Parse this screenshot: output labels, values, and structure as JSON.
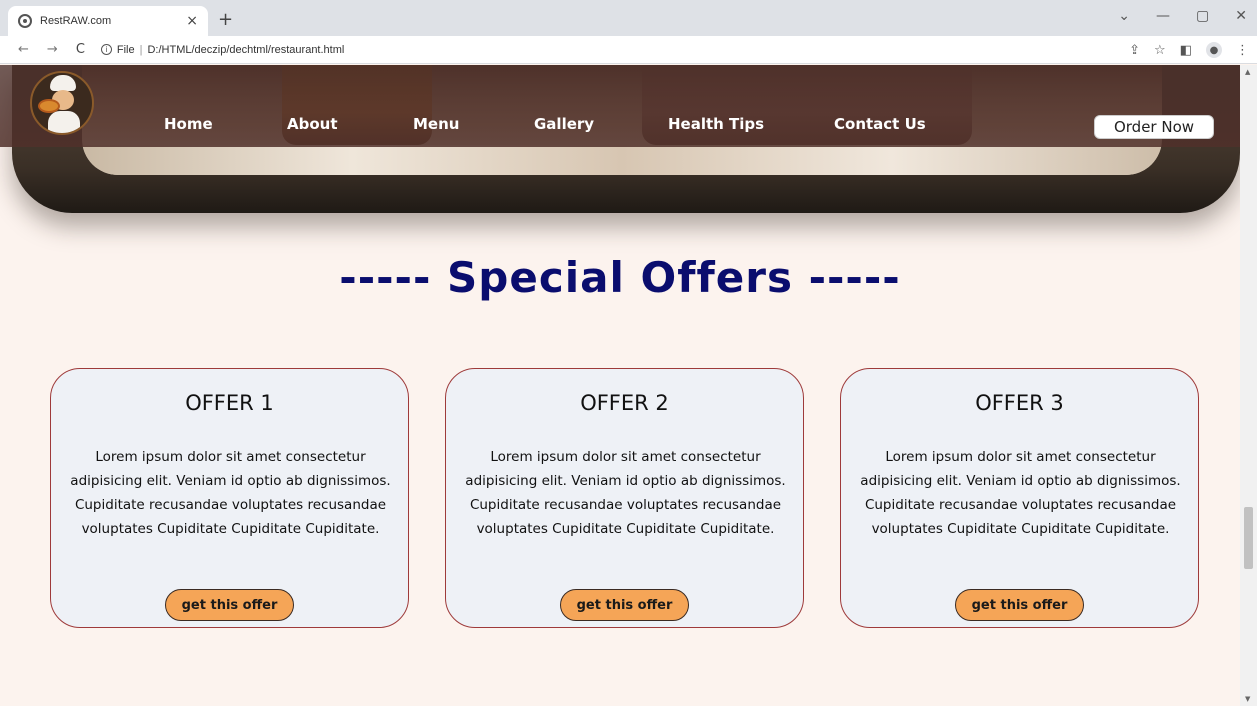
{
  "browser": {
    "tab_title": "RestRAW.com",
    "tab_close": "×",
    "new_tab": "+",
    "back": "←",
    "forward": "→",
    "reload": "C",
    "url_prefix": "File",
    "url_sep": "|",
    "url": "D:/HTML/deczip/dechtml/restaurant.html",
    "info_icon": "i",
    "share_icon": "⇪",
    "star_icon": "☆",
    "sidepanel_icon": "◧",
    "profile_icon": "●",
    "menu_icon": "⋮",
    "minimize": "—",
    "restore": "▢",
    "close": "✕",
    "chevron": "⌄"
  },
  "nav": {
    "items": [
      {
        "label": "Home"
      },
      {
        "label": "About"
      },
      {
        "label": "Menu"
      },
      {
        "label": "Gallery"
      },
      {
        "label": "Health Tips"
      },
      {
        "label": "Contact Us"
      }
    ],
    "order_label": "Order Now"
  },
  "section": {
    "title": "----- Special Offers -----"
  },
  "offers": [
    {
      "title": "OFFER 1",
      "text": "Lorem ipsum dolor sit amet consectetur adipisicing elit. Veniam id optio ab dignissimos. Cupiditate recusandae voluptates recusandae voluptates Cupiditate Cupiditate Cupiditate.",
      "button": "get this offer"
    },
    {
      "title": "OFFER 2",
      "text": "Lorem ipsum dolor sit amet consectetur adipisicing elit. Veniam id optio ab dignissimos. Cupiditate recusandae voluptates recusandae voluptates Cupiditate Cupiditate Cupiditate.",
      "button": "get this offer"
    },
    {
      "title": "OFFER 3",
      "text": "Lorem ipsum dolor sit amet consectetur adipisicing elit. Veniam id optio ab dignissimos. Cupiditate recusandae voluptates recusandae voluptates Cupiditate Cupiditate Cupiditate.",
      "button": "get this offer"
    }
  ],
  "colors": {
    "title": "#0a0d6e",
    "button": "#f5a557",
    "card_border": "#9e3a3a",
    "page_bg": "#fcf3ee"
  }
}
